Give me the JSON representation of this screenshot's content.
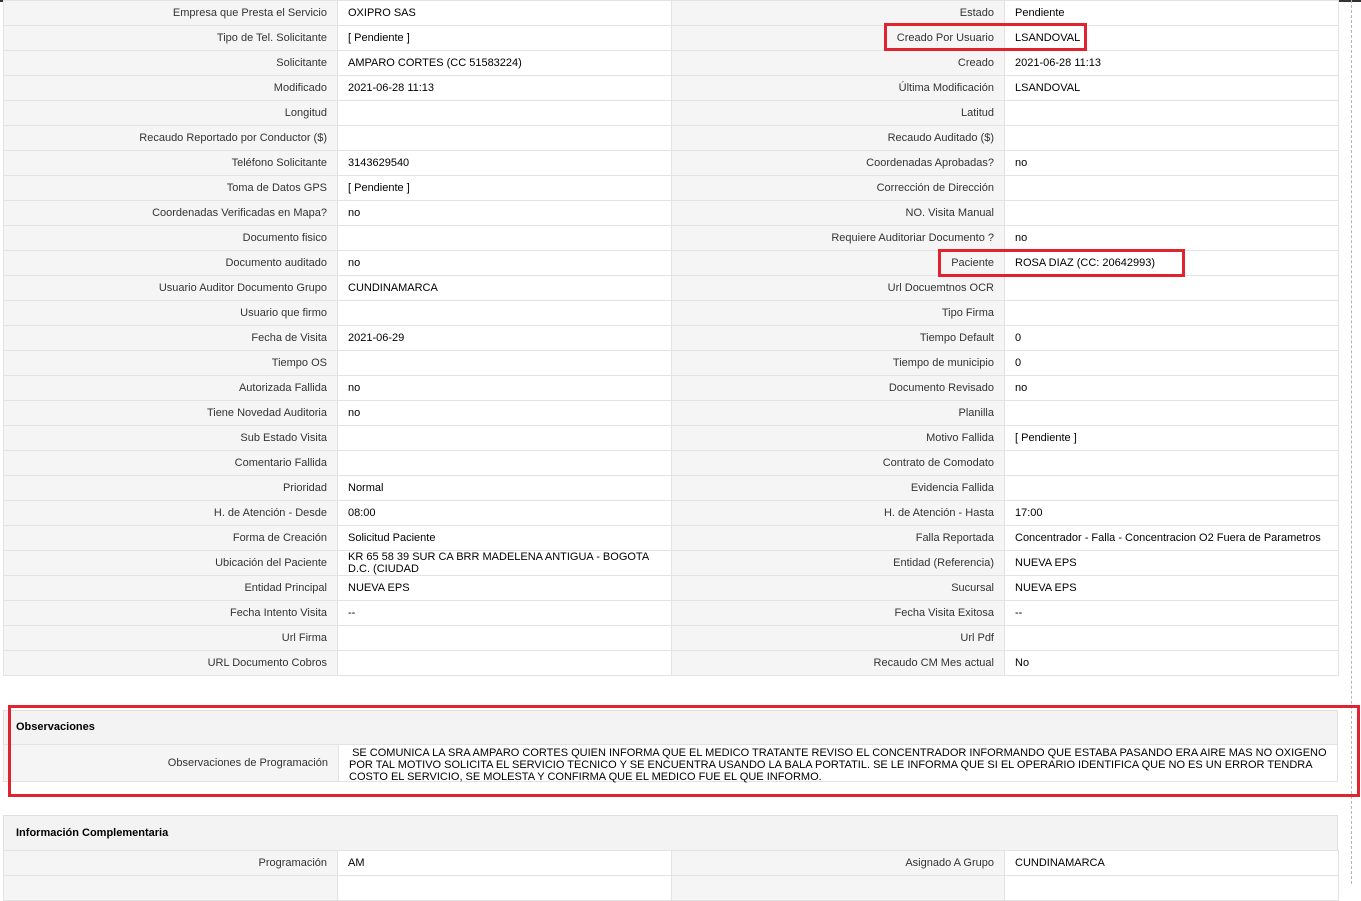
{
  "details": {
    "rows": [
      {
        "l1": "Empresa que Presta el Servicio",
        "v1": "OXIPRO SAS",
        "l2": "Estado",
        "v2": "Pendiente"
      },
      {
        "l1": "Tipo de Tel. Solicitante",
        "v1": "[ Pendiente ]",
        "l2": "Creado Por Usuario",
        "v2": "LSANDOVAL"
      },
      {
        "l1": "Solicitante",
        "v1": "AMPARO CORTES (CC 51583224)",
        "l2": "Creado",
        "v2": "2021-06-28 11:13"
      },
      {
        "l1": "Modificado",
        "v1": "2021-06-28 11:13",
        "l2": "Última Modificación",
        "v2": " LSANDOVAL"
      },
      {
        "l1": "Longitud",
        "v1": "",
        "l2": "Latitud",
        "v2": ""
      },
      {
        "l1": "Recaudo Reportado por Conductor ($)",
        "v1": "",
        "l2": "Recaudo Auditado ($)",
        "v2": ""
      },
      {
        "l1": "Teléfono Solicitante",
        "v1": "3143629540",
        "l2": "Coordenadas Aprobadas?",
        "v2": " no"
      },
      {
        "l1": "Toma de Datos GPS",
        "v1": "[ Pendiente ]",
        "l2": "Corrección de Dirección",
        "v2": ""
      },
      {
        "l1": "Coordenadas Verificadas en Mapa?",
        "v1": " no",
        "l2": "NO. Visita Manual",
        "v2": ""
      },
      {
        "l1": "Documento fisico",
        "v1": "",
        "l2": "Requiere Auditoriar Documento ?",
        "v2": " no"
      },
      {
        "l1": "Documento auditado",
        "v1": " no",
        "l2": "Paciente",
        "v2": "ROSA DIAZ (CC: 20642993)"
      },
      {
        "l1": "Usuario Auditor Documento Grupo",
        "v1": "CUNDINAMARCA",
        "l2": "Url Docuemtnos OCR",
        "v2": ""
      },
      {
        "l1": "Usuario que firmo",
        "v1": "",
        "l2": "Tipo Firma",
        "v2": ""
      },
      {
        "l1": "Fecha de Visita",
        "v1": " 2021-06-29",
        "l2": "Tiempo Default",
        "v2": "0"
      },
      {
        "l1": "Tiempo OS",
        "v1": "",
        "l2": "Tiempo de municipio",
        "v2": "0"
      },
      {
        "l1": "Autorizada Fallida",
        "v1": " no",
        "l2": "Documento Revisado",
        "v2": " no"
      },
      {
        "l1": "Tiene Novedad Auditoria",
        "v1": " no",
        "l2": "Planilla",
        "v2": ""
      },
      {
        "l1": "Sub Estado Visita",
        "v1": "",
        "l2": "Motivo Fallida",
        "v2": "[ Pendiente ]"
      },
      {
        "l1": "Comentario Fallida",
        "v1": "",
        "l2": "Contrato de Comodato",
        "v2": ""
      },
      {
        "l1": "Prioridad",
        "v1": "Normal",
        "l2": "Evidencia Fallida",
        "v2": ""
      },
      {
        "l1": "H. de Atención - Desde",
        "v1": "08:00",
        "l2": "H. de Atención - Hasta",
        "v2": "17:00"
      },
      {
        "l1": "Forma de Creación",
        "v1": "Solicitud Paciente",
        "l2": "Falla Reportada",
        "v2": "Concentrador - Falla - Concentracion O2 Fuera de Parametros"
      },
      {
        "l1": "Ubicación del Paciente",
        "v1": "KR 65 58 39 SUR CA BRR MADELENA ANTIGUA - BOGOTA D.C. (CIUDAD",
        "l2": "Entidad (Referencia)",
        "v2": "NUEVA EPS"
      },
      {
        "l1": "Entidad Principal",
        "v1": "NUEVA EPS",
        "l2": "Sucursal",
        "v2": "NUEVA EPS"
      },
      {
        "l1": "Fecha Intento Visita",
        "v1": " --",
        "l2": "Fecha Visita Exitosa",
        "v2": " --"
      },
      {
        "l1": "Url Firma",
        "v1": "",
        "l2": "Url Pdf",
        "v2": ""
      },
      {
        "l1": "URL Documento Cobros",
        "v1": "",
        "l2": "Recaudo CM Mes actual",
        "v2": "No"
      }
    ]
  },
  "observaciones": {
    "title": "Observaciones",
    "label": "Observaciones de Programación",
    "text": " SE COMUNICA LA SRA AMPARO CORTES QUIEN INFORMA QUE EL MEDICO TRATANTE REVISO EL CONCENTRADOR INFORMANDO QUE ESTABA PASANDO ERA AIRE MAS NO OXIGENO POR TAL MOTIVO SOLICITA EL SERVICIO TECNICO Y SE ENCUENTRA USANDO LA BALA PORTATIL. SE LE INFORMA QUE SI EL OPERARIO IDENTIFICA QUE NO ES UN ERROR TENDRA COSTO EL SERVICIO, SE MOLESTA Y CONFIRMA QUE EL MEDICO FUE EL QUE INFORMO."
  },
  "complementaria": {
    "title": "Información Complementaria",
    "rows": [
      {
        "l1": "Programación",
        "v1": "AM",
        "l2": "Asignado A Grupo",
        "v2": "CUNDINAMARCA"
      },
      {
        "l1": "",
        "v1": "",
        "l2": "",
        "v2": ""
      }
    ]
  },
  "colors": {
    "highlight": "#e0232e",
    "label_bg": "#f5f5f5",
    "border": "#e3e3e3"
  }
}
